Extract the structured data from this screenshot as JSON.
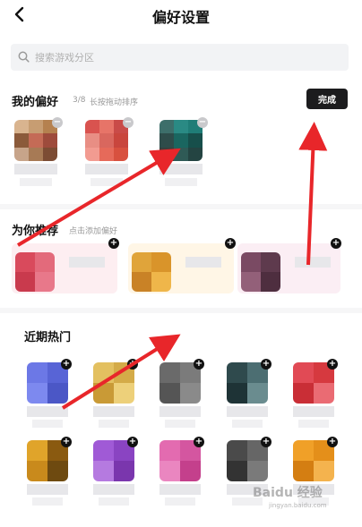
{
  "header": {
    "title": "偏好设置",
    "back_icon": "back-arrow-icon"
  },
  "search": {
    "placeholder": "搜索游戏分区",
    "icon": "search-icon"
  },
  "favorites": {
    "title": "我的偏好",
    "count": "3/8",
    "hint": "长按拖动排序",
    "done_label": "完成",
    "items": [
      {
        "colors": [
          "#d9b48f",
          "#c79d72",
          "#b5814f",
          "#8b5a3a",
          "#c46b56",
          "#9e4b3c",
          "#c7a48a",
          "#a77a55",
          "#7c4c34"
        ]
      },
      {
        "colors": [
          "#d9534f",
          "#e77468",
          "#c94b48",
          "#e88e84",
          "#d9675e",
          "#c9463d",
          "#f29b91",
          "#e66a5a",
          "#d8513f"
        ]
      },
      {
        "colors": [
          "#3d6e6a",
          "#2a8a84",
          "#1f7d77",
          "#2e4c4a",
          "#1a6660",
          "#174f4b",
          "#3b3f3c",
          "#2f5a56",
          "#244442"
        ]
      }
    ]
  },
  "recommend": {
    "title": "为你推荐",
    "hint": "点击添加偏好",
    "items": [
      {
        "bg": "#fdeef1",
        "colors": [
          "#d94a5c",
          "#e36a7b",
          "#c93a4d",
          "#e8788a"
        ]
      },
      {
        "bg": "#fff6e6",
        "colors": [
          "#e0a43a",
          "#d9942a",
          "#c98226",
          "#efb64a"
        ]
      },
      {
        "bg": "#fbeef4",
        "colors": [
          "#7a4a63",
          "#5e3a4d",
          "#936079",
          "#4e2e3f"
        ]
      }
    ]
  },
  "recent": {
    "title": "近期热门",
    "rows": [
      [
        {
          "colors": [
            "#6c78e6",
            "#5864d6",
            "#7d89ef",
            "#4b57c6"
          ]
        },
        {
          "colors": [
            "#e3c060",
            "#d4ab48",
            "#c99a36",
            "#edd07a"
          ]
        },
        {
          "colors": [
            "#6a6a6a",
            "#7b7b7b",
            "#555",
            "#8a8a8a"
          ]
        },
        {
          "colors": [
            "#2f4a4d",
            "#4c6e72",
            "#1e3336",
            "#6a8c8f"
          ]
        },
        {
          "colors": [
            "#e14a55",
            "#d6393f",
            "#c92e36",
            "#ea6b73"
          ]
        }
      ],
      [
        {
          "colors": [
            "#e0a42a",
            "#8a5a10",
            "#c98a1c",
            "#6e4a10"
          ]
        },
        {
          "colors": [
            "#a05ad6",
            "#8a44c2",
            "#b57ae0",
            "#7a36ad"
          ]
        },
        {
          "colors": [
            "#e36bb0",
            "#d456a0",
            "#ea86c0",
            "#c4408c"
          ]
        },
        {
          "colors": [
            "#4a4a4a",
            "#666",
            "#333",
            "#7a7a7a"
          ]
        },
        {
          "colors": [
            "#f0a028",
            "#e48f1a",
            "#d47e12",
            "#f4b34e"
          ]
        }
      ]
    ]
  },
  "watermark": {
    "text": "Baidu 经验",
    "url_text": "jingyan.baidu.com"
  },
  "colors": {
    "accent_arrow": "#e8262a",
    "done_bg": "#1c1c1e"
  }
}
